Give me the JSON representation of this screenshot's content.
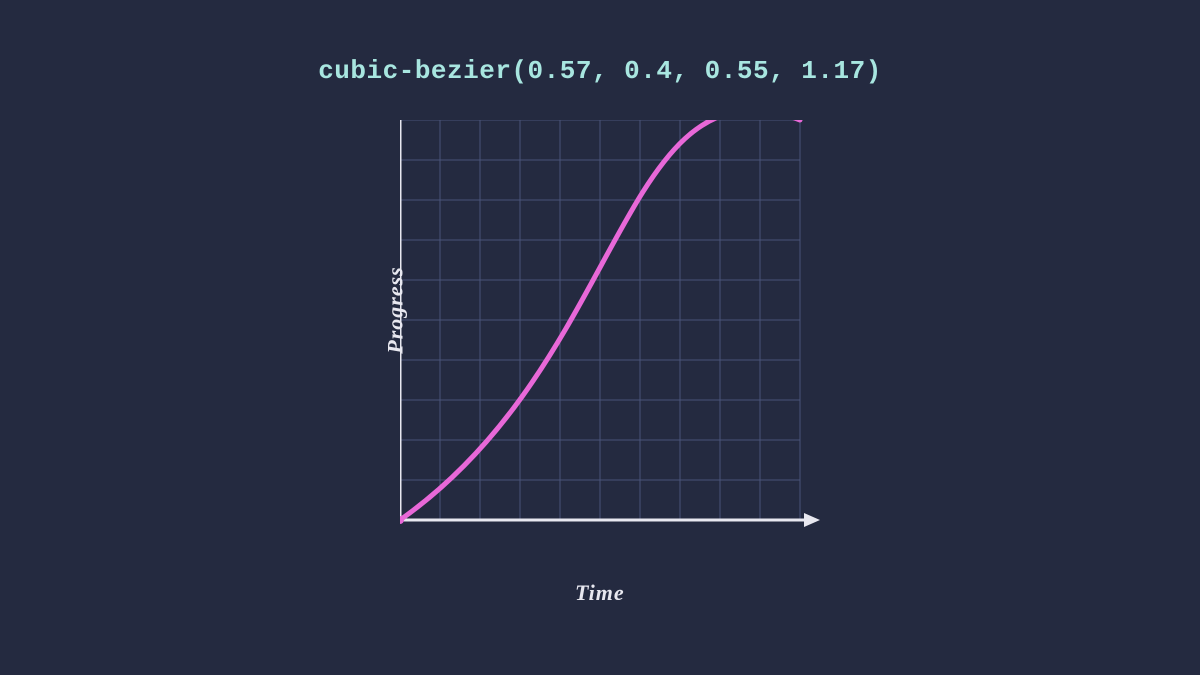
{
  "title": "cubic-bezier(0.57, 0.4, 0.55, 1.17)",
  "ylabel": "Progress",
  "xlabel": "Time",
  "chart_data": {
    "type": "line",
    "title": "cubic-bezier(0.57, 0.4, 0.55, 1.17)",
    "xlabel": "Time",
    "ylabel": "Progress",
    "xlim": [
      0,
      1
    ],
    "ylim": [
      0,
      1
    ],
    "bezier_control_points": {
      "p0": [
        0,
        0
      ],
      "p1": [
        0.57,
        0.4
      ],
      "p2": [
        0.55,
        1.17
      ],
      "p3": [
        1,
        1
      ]
    },
    "grid": true,
    "grid_divisions": 10
  },
  "colors": {
    "background": "#242a40",
    "title": "#a8e6e0",
    "axis": "#e8e8f0",
    "grid": "#5a6590",
    "curve": "#e868d8",
    "label": "#e8e8f0"
  }
}
